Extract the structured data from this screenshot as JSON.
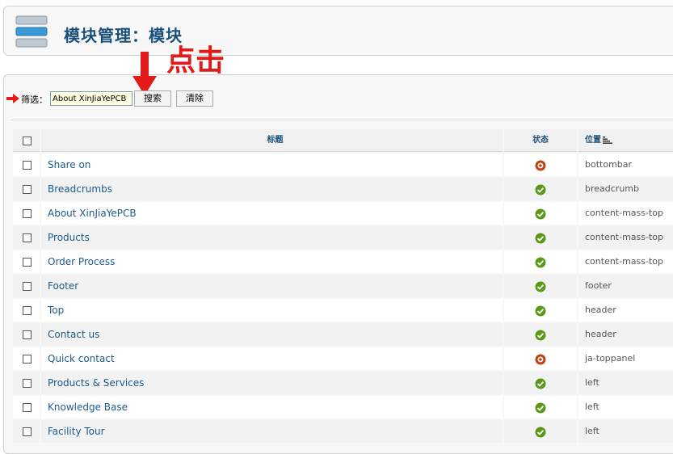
{
  "header": {
    "title": "模块管理：模块"
  },
  "filter": {
    "label": "筛选：",
    "value": "About XinJiaYePCB",
    "search_label": "搜索",
    "reset_label": "清除"
  },
  "annotation": {
    "text": "点击"
  },
  "table": {
    "headers": {
      "title": "标题",
      "status": "状态",
      "position": "位置"
    },
    "rows": [
      {
        "title": "Share on",
        "status": "disabled",
        "position": "bottombar"
      },
      {
        "title": "Breadcrumbs",
        "status": "enabled",
        "position": "breadcrumb"
      },
      {
        "title": "About XinJiaYePCB",
        "status": "enabled",
        "position": "content-mass-top"
      },
      {
        "title": "Products",
        "status": "enabled",
        "position": "content-mass-top"
      },
      {
        "title": "Order Process",
        "status": "enabled",
        "position": "content-mass-top"
      },
      {
        "title": "Footer",
        "status": "enabled",
        "position": "footer"
      },
      {
        "title": "Top",
        "status": "enabled",
        "position": "header"
      },
      {
        "title": "Contact us",
        "status": "enabled",
        "position": "header"
      },
      {
        "title": "Quick contact",
        "status": "disabled",
        "position": "ja-toppanel"
      },
      {
        "title": "Products & Services",
        "status": "enabled",
        "position": "left"
      },
      {
        "title": "Knowledge Base",
        "status": "enabled",
        "position": "left"
      },
      {
        "title": "Facility Tour",
        "status": "enabled",
        "position": "left"
      }
    ]
  },
  "colors": {
    "enabled": "#5a9a1a",
    "disabled": "#c0461a",
    "annotation": "#e21a1a",
    "title_link": "#1b5b8b"
  }
}
